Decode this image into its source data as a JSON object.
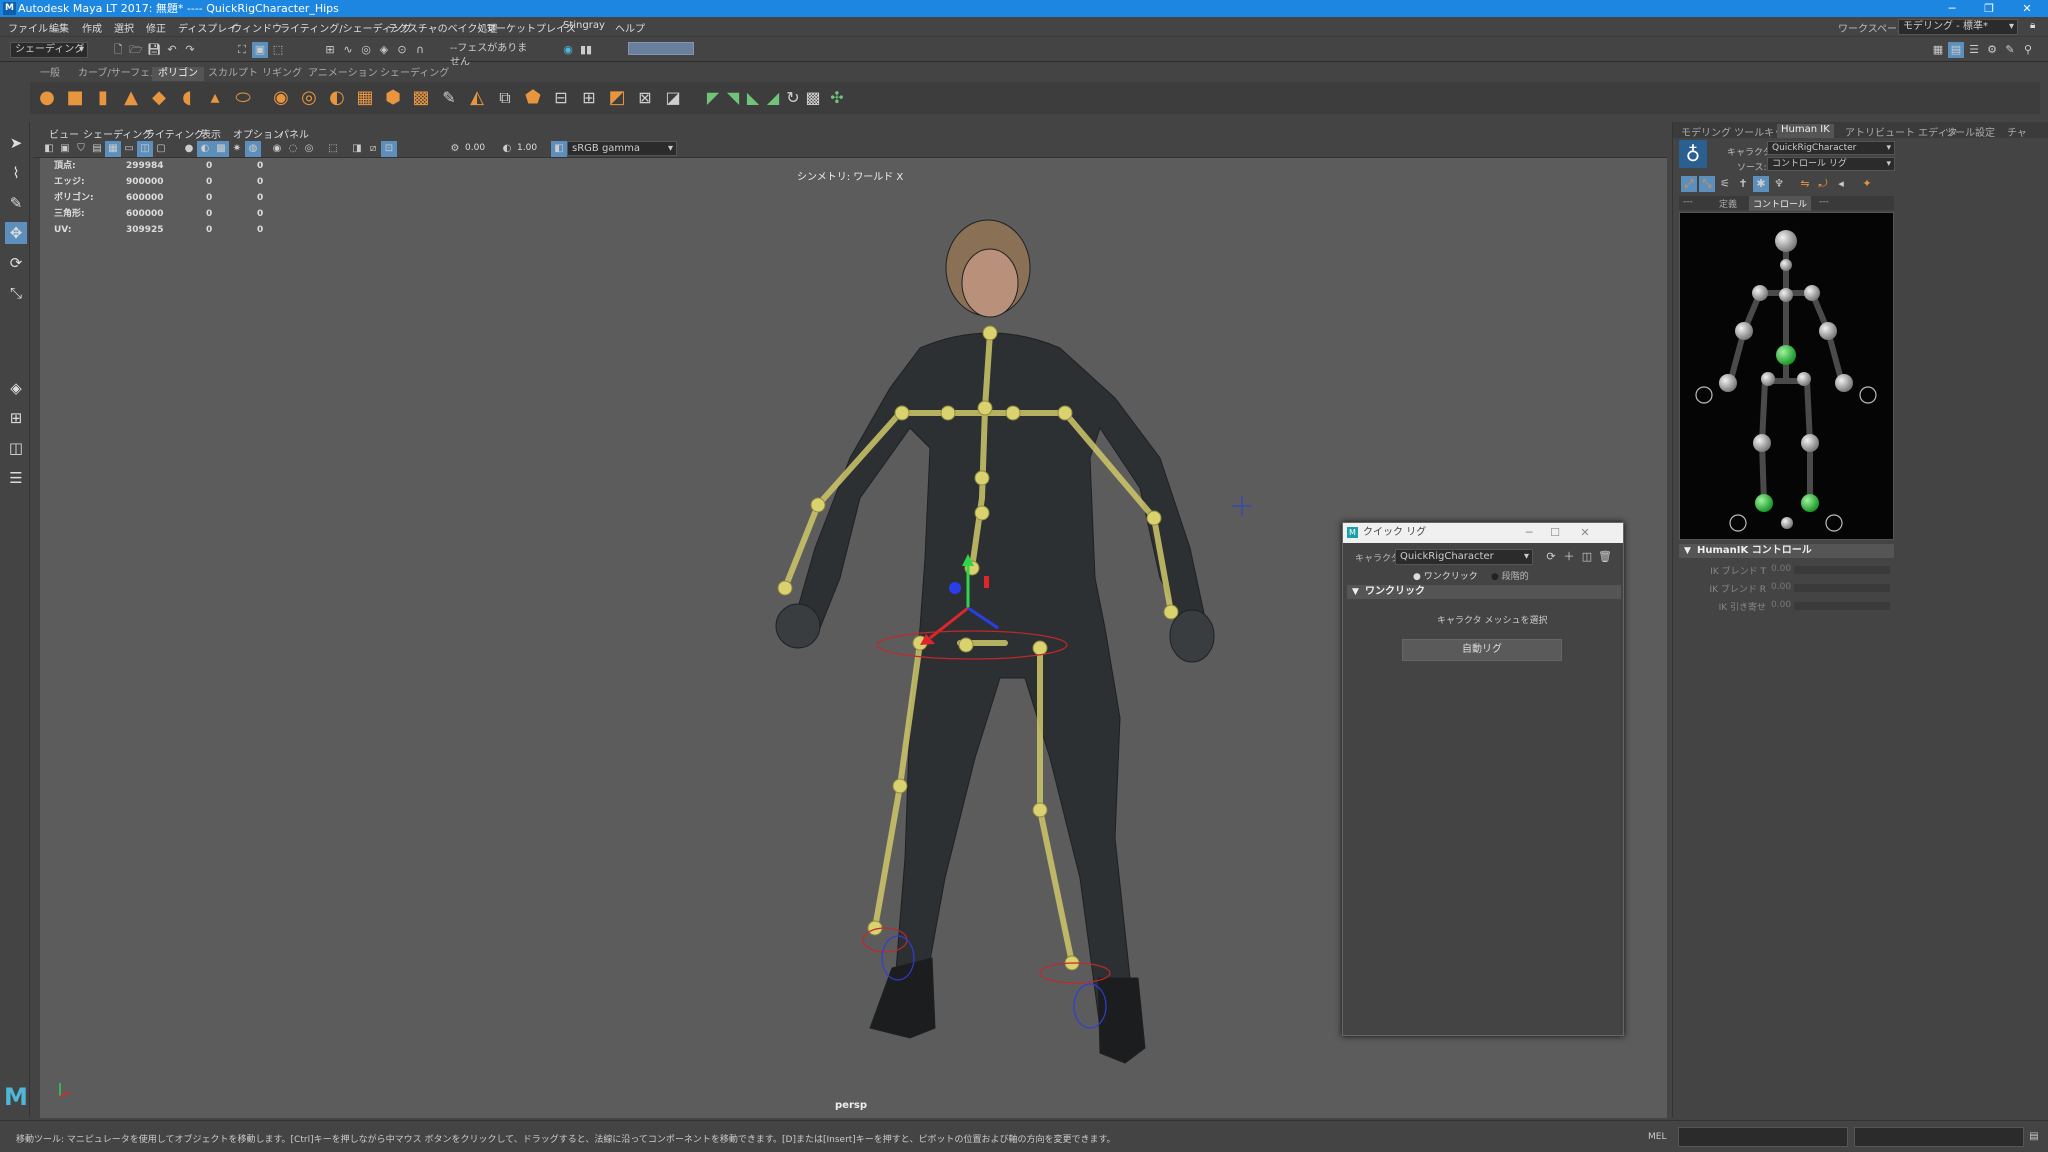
{
  "title_bar": {
    "logo_letter": "M",
    "title": "Autodesk Maya LT 2017: 無題*   ----   QuickRigCharacter_Hips",
    "minimize": "─",
    "maximize": "❐",
    "close": "✕"
  },
  "menu_bar": {
    "items": [
      "ファイル",
      "編集",
      "作成",
      "選択",
      "修正",
      "ディスプレイ",
      "ウィンドウ",
      "ライティング/シェーディング",
      "テクスチャのベイク処理",
      "マーケットプレイス",
      "Stingray",
      "ヘルプ"
    ],
    "workspace_label": "ワークスペース:",
    "workspace_value": "モデリング - 標準*"
  },
  "status_line": {
    "mode": "シェーディング",
    "face_field": "--フェスがありません"
  },
  "shelf": {
    "tabs": [
      "一般",
      "カーブ/サーフェス",
      "ポリゴン",
      "スカルプト",
      "リギング",
      "アニメーション",
      "シェーディング"
    ],
    "active_tab": "ポリゴン"
  },
  "viewport": {
    "menu": [
      "ビュー",
      "シェーディング",
      "ライティング",
      "表示",
      "オプション",
      "パネル"
    ],
    "exposure": "0.00",
    "gamma": "1.00",
    "color_space": "sRGB gamma",
    "symmetry_label": "シンメトリ: ワールド X",
    "camera_label": "persp",
    "hud": [
      {
        "label": "頂点:",
        "v1": "299984",
        "v2": "0",
        "v3": "0"
      },
      {
        "label": "エッジ:",
        "v1": "900000",
        "v2": "0",
        "v3": "0"
      },
      {
        "label": "ポリゴン:",
        "v1": "600000",
        "v2": "0",
        "v3": "0"
      },
      {
        "label": "三角形:",
        "v1": "600000",
        "v2": "0",
        "v3": "0"
      },
      {
        "label": "UV:",
        "v1": "309925",
        "v2": "0",
        "v3": "0"
      }
    ]
  },
  "right_panel": {
    "tabs": [
      "モデリング ツールキット",
      "Human IK",
      "アトリビュート エディタ",
      "ツール設定",
      "チャ"
    ],
    "active_tab": "Human IK",
    "character_label": "キャラクタ:",
    "character_value": "QuickRigCharacter",
    "source_label": "ソース:",
    "source_value": "コントロール リグ",
    "subtabs": [
      "---",
      "定義",
      "コントロール",
      "---"
    ],
    "active_subtab": "コントロール",
    "control_section": "HumanIK コントロール",
    "sliders": [
      {
        "label": "IK ブレンド T",
        "value": "0.00"
      },
      {
        "label": "IK ブレンド R",
        "value": "0.00"
      },
      {
        "label": "IK 引き寄せ",
        "value": "0.00"
      }
    ]
  },
  "quick_rig": {
    "title": "クイック リグ",
    "character_label": "キャラクタ:",
    "character_value": "QuickRigCharacter",
    "mode_one_click": "ワンクリック",
    "mode_step": "段階的",
    "section": "ワンクリック",
    "select_mesh_text": "キャラクタ メッシュを選択",
    "auto_rig_button": "自動リグ"
  },
  "help_line": {
    "text": "移動ツール: マニピュレータを使用してオブジェクトを移動します。[Ctrl]キーを押しながら中マウス ボタンをクリックして、ドラッグすると、法線に沿ってコンポーネントを移動できます。[D]または[Insert]キーを押すと、ピボットの位置および軸の方向を変更できます。",
    "mel_label": "MEL"
  }
}
